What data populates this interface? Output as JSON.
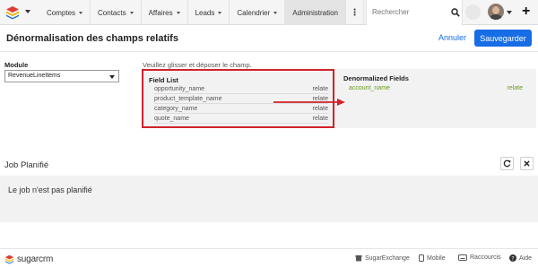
{
  "nav": {
    "items": [
      {
        "label": "Comptes"
      },
      {
        "label": "Contacts"
      },
      {
        "label": "Affaires"
      },
      {
        "label": "Leads"
      },
      {
        "label": "Calendrier"
      },
      {
        "label": "Administration"
      }
    ],
    "search_placeholder": "Rechercher"
  },
  "header": {
    "title": "Dénormalisation des champs relatifs",
    "cancel_label": "Annuler",
    "save_label": "Sauvegarder"
  },
  "module": {
    "label": "Module",
    "selected": "RevenueLineItems"
  },
  "instructions": "Veuillez glisser et déposer le champ.",
  "field_list": {
    "title": "Field List",
    "rows": [
      {
        "name": "opportunity_name",
        "type": "relate"
      },
      {
        "name": "product_template_name",
        "type": "relate"
      },
      {
        "name": "category_name",
        "type": "relate"
      },
      {
        "name": "quote_name",
        "type": "relate"
      }
    ]
  },
  "denormalized": {
    "title": "Denormalized Fields",
    "rows": [
      {
        "name": "account_name",
        "type": "relate"
      }
    ]
  },
  "job": {
    "title": "Job Planifié",
    "status": "Le job n'est pas planifié"
  },
  "footer": {
    "brand": "sugarcrm",
    "links": [
      "SugarExchange",
      "Mobile",
      "Raccourcis",
      "Aide"
    ]
  },
  "colors": {
    "accent": "#176de5",
    "highlight_red": "#d0222a",
    "relate_green": "#6b9a1f"
  }
}
